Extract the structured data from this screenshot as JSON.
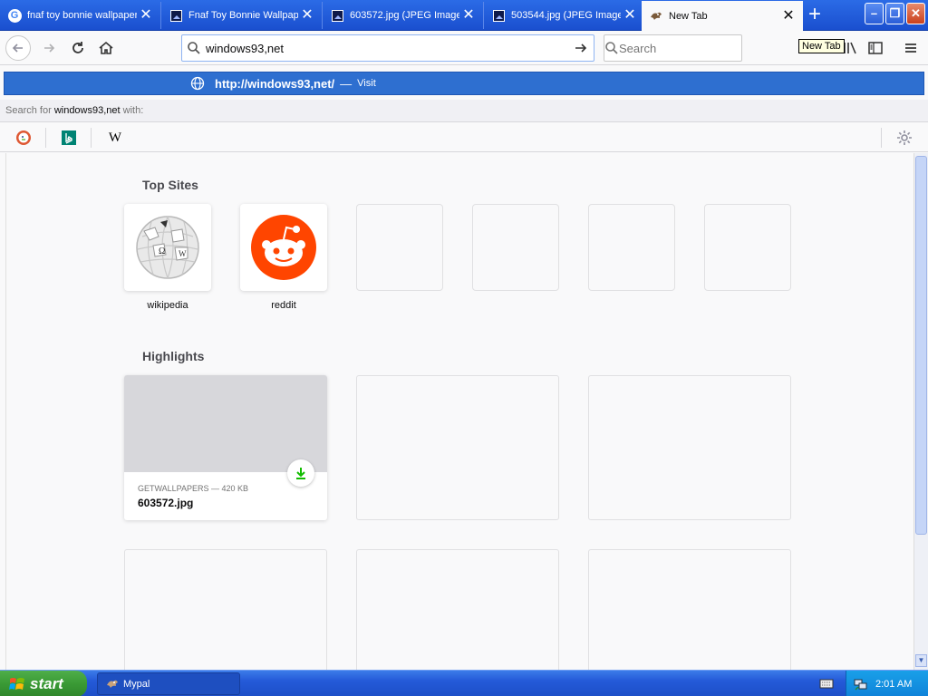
{
  "tabs": [
    {
      "title": "fnaf toy bonnie wallpaper",
      "icon": "google-icon",
      "active": false
    },
    {
      "title": "Fnaf Toy Bonnie Wallpaper",
      "icon": "image-icon",
      "active": false
    },
    {
      "title": "603572.jpg (JPEG Image",
      "icon": "image-icon",
      "active": false
    },
    {
      "title": "503544.jpg (JPEG Image",
      "icon": "image-icon",
      "active": false
    },
    {
      "title": "New Tab",
      "icon": "mypal-icon",
      "active": true
    }
  ],
  "tooltip": "New Tab",
  "urlbar": {
    "value": "windows93,net"
  },
  "searchbox": {
    "placeholder": "Search"
  },
  "suggestion": {
    "url": "http://windows93,net/",
    "separator": "—",
    "action": "Visit"
  },
  "search_for": {
    "prefix": "Search for ",
    "query": "windows93,net",
    "suffix": " with:"
  },
  "engines": [
    "duckduckgo-icon",
    "bing-icon",
    "wikipedia-icon"
  ],
  "newtab": {
    "top_sites_title": "Top Sites",
    "top_sites": [
      {
        "label": "wikipedia"
      },
      {
        "label": "reddit"
      }
    ],
    "highlights_title": "Highlights",
    "highlight": {
      "source": "GETWALLPAPERS — 420 KB",
      "filename": "603572.jpg"
    }
  },
  "taskbar": {
    "start_label": "start",
    "task_label": "Mypal",
    "clock": "2:01 AM"
  },
  "colors": {
    "accent": "#2e6fd0",
    "taskbar": "#245ad8",
    "start": "#3a9a35",
    "reddit": "#ff4500"
  }
}
